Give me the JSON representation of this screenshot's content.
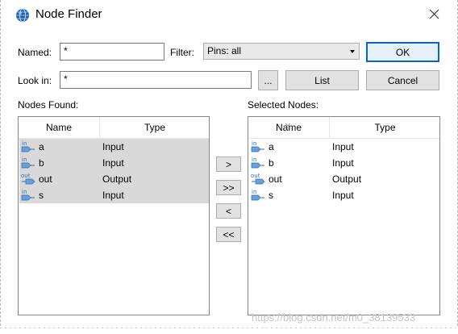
{
  "window": {
    "title": "Node Finder",
    "app_icon": "quartus-globe-icon",
    "close_icon": "close-icon"
  },
  "search": {
    "named_label": "Named:",
    "named_value": "*",
    "filter_label": "Filter:",
    "filter_value": "Pins: all",
    "look_in_label": "Look in:",
    "look_in_value": "*",
    "browse_label": "...",
    "list_label": "List",
    "ok_label": "OK",
    "cancel_label": "Cancel"
  },
  "nodes_found": {
    "title": "Nodes Found:",
    "columns": [
      "Name",
      "Type"
    ],
    "rows": [
      {
        "pin": "in",
        "name": "a",
        "type": "Input"
      },
      {
        "pin": "in",
        "name": "b",
        "type": "Input"
      },
      {
        "pin": "out",
        "name": "out",
        "type": "Output"
      },
      {
        "pin": "in",
        "name": "s",
        "type": "Input"
      }
    ]
  },
  "transfer": {
    "add": ">",
    "add_all": ">>",
    "remove": "<",
    "remove_all": "<<"
  },
  "selected_nodes": {
    "title": "Selected Nodes:",
    "columns": [
      "Name",
      "Type"
    ],
    "rows": [
      {
        "pin": "in",
        "name": "a",
        "type": "Input"
      },
      {
        "pin": "in",
        "name": "b",
        "type": "Input"
      },
      {
        "pin": "out",
        "name": "out",
        "type": "Output"
      },
      {
        "pin": "in",
        "name": "s",
        "type": "Input"
      }
    ]
  },
  "watermark": "https://blog.csdn.net/m0_38139533",
  "colors": {
    "selection": "#d9d9d9",
    "default_button_border": "#0a63c8",
    "pin_blue": "#2f6db5"
  }
}
